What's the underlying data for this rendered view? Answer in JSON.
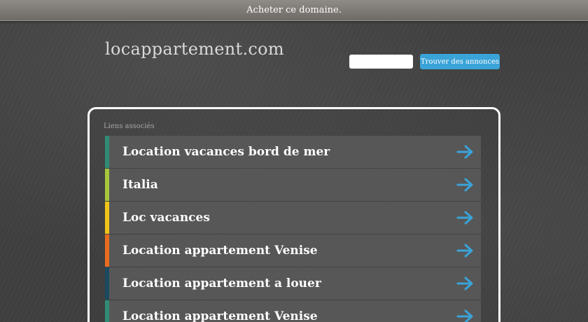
{
  "topbar": {
    "buy_label": "Acheter ce domaine."
  },
  "header": {
    "logo": "locappartement.com",
    "search": {
      "value": "",
      "placeholder": "",
      "button_label": "Trouver des annonces"
    }
  },
  "panel": {
    "title": "Liens associés",
    "links": [
      {
        "label": "Location vacances bord de mer",
        "accent": "#2f8c74"
      },
      {
        "label": "Italia",
        "accent": "#a6c63b"
      },
      {
        "label": "Loc vacances",
        "accent": "#f0c418"
      },
      {
        "label": "Location appartement Venise",
        "accent": "#e86c1f"
      },
      {
        "label": "Location appartement a louer",
        "accent": "#1c4a60"
      },
      {
        "label": "Location appartement Venise",
        "accent": "#2f8c74"
      }
    ]
  },
  "icons": {
    "link_arrow": "arrow-right-icon"
  },
  "colors": {
    "arrow": "#3aa3d8",
    "button": "#3aa3d8"
  }
}
